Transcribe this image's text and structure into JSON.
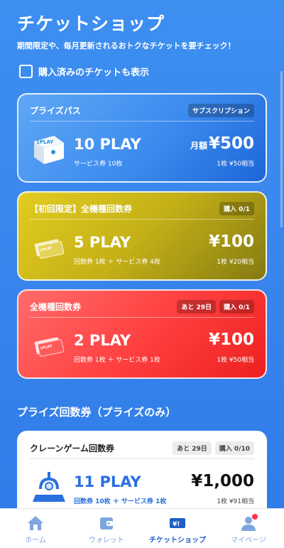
{
  "header": {
    "title": "チケットショップ",
    "subtitle": "期間限定や、毎月更新されるおトクなチケットを要チェック！"
  },
  "filter": {
    "label": "購入済みのチケットも表示",
    "checked": false
  },
  "cards": {
    "pass": {
      "title": "プライズパス",
      "badge": "サブスクリプション",
      "plays": "10 PLAY",
      "detail": "サービス券 10枚",
      "price_prefix": "月額",
      "price": "¥500",
      "unit_price": "1枚 ¥50相当",
      "thumb_label": "1PLAY"
    },
    "first": {
      "title": "【初回限定】全機種回数券",
      "badge": "購入 0/1",
      "plays": "5 PLAY",
      "detail": "回数券 1枚 ＋ サービス券 4枚",
      "price": "¥100",
      "unit_price": "1枚 ¥20相当",
      "thumb_label": "1PLAY"
    },
    "all": {
      "title": "全機種回数券",
      "badge_days": "あと 29日",
      "badge": "購入 0/1",
      "plays": "2 PLAY",
      "detail": "回数券 1枚 ＋ サービス券 1枚",
      "price": "¥100",
      "unit_price": "1枚 ¥50相当",
      "thumb_label": "1PLAY"
    },
    "crane": {
      "title": "クレーンゲーム回数券",
      "badge_days": "あと 29日",
      "badge": "購入 0/10",
      "plays": "11 PLAY",
      "detail": "回数券 10枚 ＋ サービス券 1枚",
      "price": "¥1,000",
      "unit_price": "1枚 ¥91相当"
    }
  },
  "section": {
    "title": "プライズ回数券（プライズのみ）"
  },
  "tabs": [
    {
      "label": "ホーム",
      "icon": "home-icon"
    },
    {
      "label": "ウォレット",
      "icon": "wallet-icon"
    },
    {
      "label": "チケットショップ",
      "icon": "ticket-icon",
      "active": true,
      "icon_text": "¥!"
    },
    {
      "label": "マイページ",
      "icon": "person-icon",
      "notification": true
    }
  ],
  "colors": {
    "background": "#3b87ee",
    "pass": "#3c8bee",
    "first": "#c4b017",
    "all": "#ff4141",
    "active_tab": "#1f5fc5",
    "inactive_tab": "#7ea6dd"
  }
}
